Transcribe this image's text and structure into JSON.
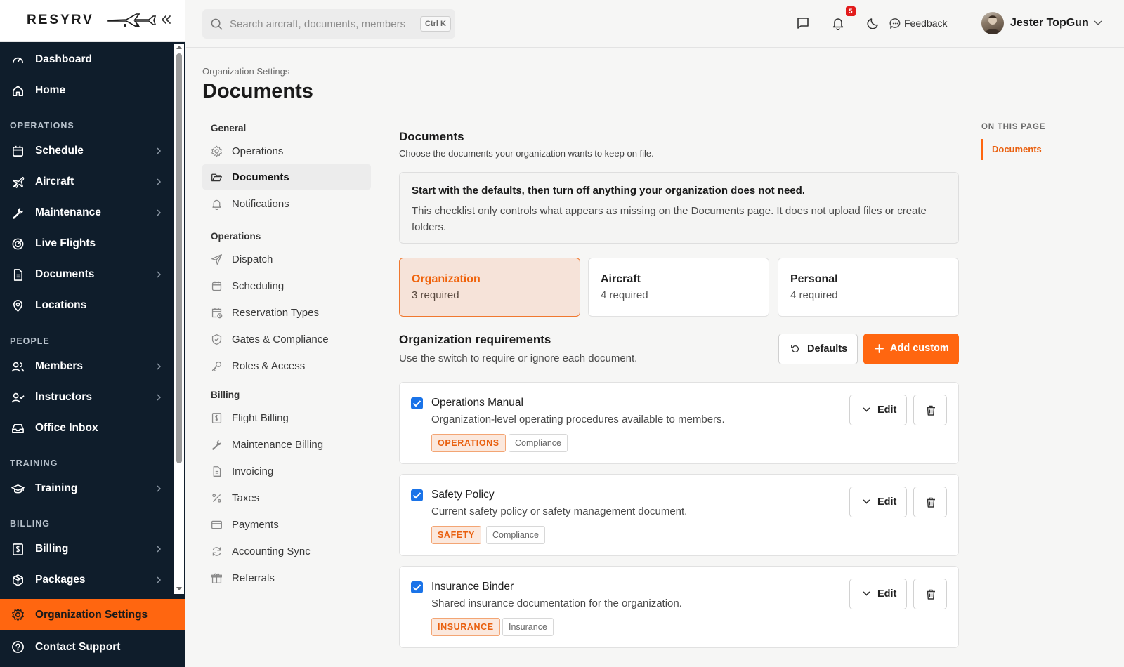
{
  "brand": {
    "logo_text": "RESYRV"
  },
  "sidebar": {
    "items": [
      {
        "label": "Dashboard"
      },
      {
        "label": "Home"
      },
      {
        "label": "Schedule"
      },
      {
        "label": "Aircraft"
      },
      {
        "label": "Maintenance"
      },
      {
        "label": "Live Flights"
      },
      {
        "label": "Documents"
      },
      {
        "label": "Locations"
      },
      {
        "label": "Members"
      },
      {
        "label": "Instructors"
      },
      {
        "label": "Office Inbox"
      },
      {
        "label": "Training"
      },
      {
        "label": "Billing"
      },
      {
        "label": "Packages"
      }
    ],
    "sections": [
      "OPERATIONS",
      "PEOPLE",
      "TRAINING",
      "BILLING"
    ],
    "org_settings": "Organization Settings",
    "contact_support": "Contact Support"
  },
  "topbar": {
    "search_placeholder": "Search aircraft, documents, members",
    "search_shortcut": "Ctrl K",
    "notifications_count": "5",
    "feedback_label": "Feedback",
    "user_name": "Jester TopGun"
  },
  "page": {
    "breadcrumb": "Organization Settings",
    "title": "Documents"
  },
  "subnav": {
    "groups": [
      "General",
      "Operations",
      "Billing"
    ],
    "items": [
      {
        "label": "Operations"
      },
      {
        "label": "Documents"
      },
      {
        "label": "Notifications"
      },
      {
        "label": "Dispatch"
      },
      {
        "label": "Scheduling"
      },
      {
        "label": "Reservation Types"
      },
      {
        "label": "Gates & Compliance"
      },
      {
        "label": "Roles & Access"
      },
      {
        "label": "Flight Billing"
      },
      {
        "label": "Maintenance Billing"
      },
      {
        "label": "Invoicing"
      },
      {
        "label": "Taxes"
      },
      {
        "label": "Payments"
      },
      {
        "label": "Accounting Sync"
      },
      {
        "label": "Referrals"
      }
    ]
  },
  "main": {
    "section_title": "Documents",
    "section_desc": "Choose the documents your organization wants to keep on file.",
    "info_title": "Start with the defaults, then turn off anything your organization does not need.",
    "info_body": "This checklist only controls what appears as missing on the Documents page. It does not upload files or create folders.",
    "categories": [
      {
        "name": "Organization",
        "count": "3 required",
        "active": true
      },
      {
        "name": "Aircraft",
        "count": "4 required",
        "active": false
      },
      {
        "name": "Personal",
        "count": "4 required",
        "active": false
      }
    ],
    "requirements_title": "Organization requirements",
    "requirements_desc": "Use the switch to require or ignore each document.",
    "defaults_label": "Defaults",
    "add_custom_label": "Add custom",
    "edit_label": "Edit",
    "documents": [
      {
        "title": "Operations Manual",
        "desc": "Organization-level operating procedures available to members.",
        "tag": "OPERATIONS",
        "type": "Compliance",
        "checked": true
      },
      {
        "title": "Safety Policy",
        "desc": "Current safety policy or safety management document.",
        "tag": "SAFETY",
        "type": "Compliance",
        "checked": true
      },
      {
        "title": "Insurance Binder",
        "desc": "Shared insurance documentation for the organization.",
        "tag": "INSURANCE",
        "type": "Insurance",
        "checked": true
      }
    ]
  },
  "on_this_page": {
    "title": "ON THIS PAGE",
    "links": [
      "Documents"
    ]
  },
  "colors": {
    "accent": "#ff6610",
    "sidebar_bg": "#0f1d2b",
    "checkbox": "#1a73e8"
  }
}
